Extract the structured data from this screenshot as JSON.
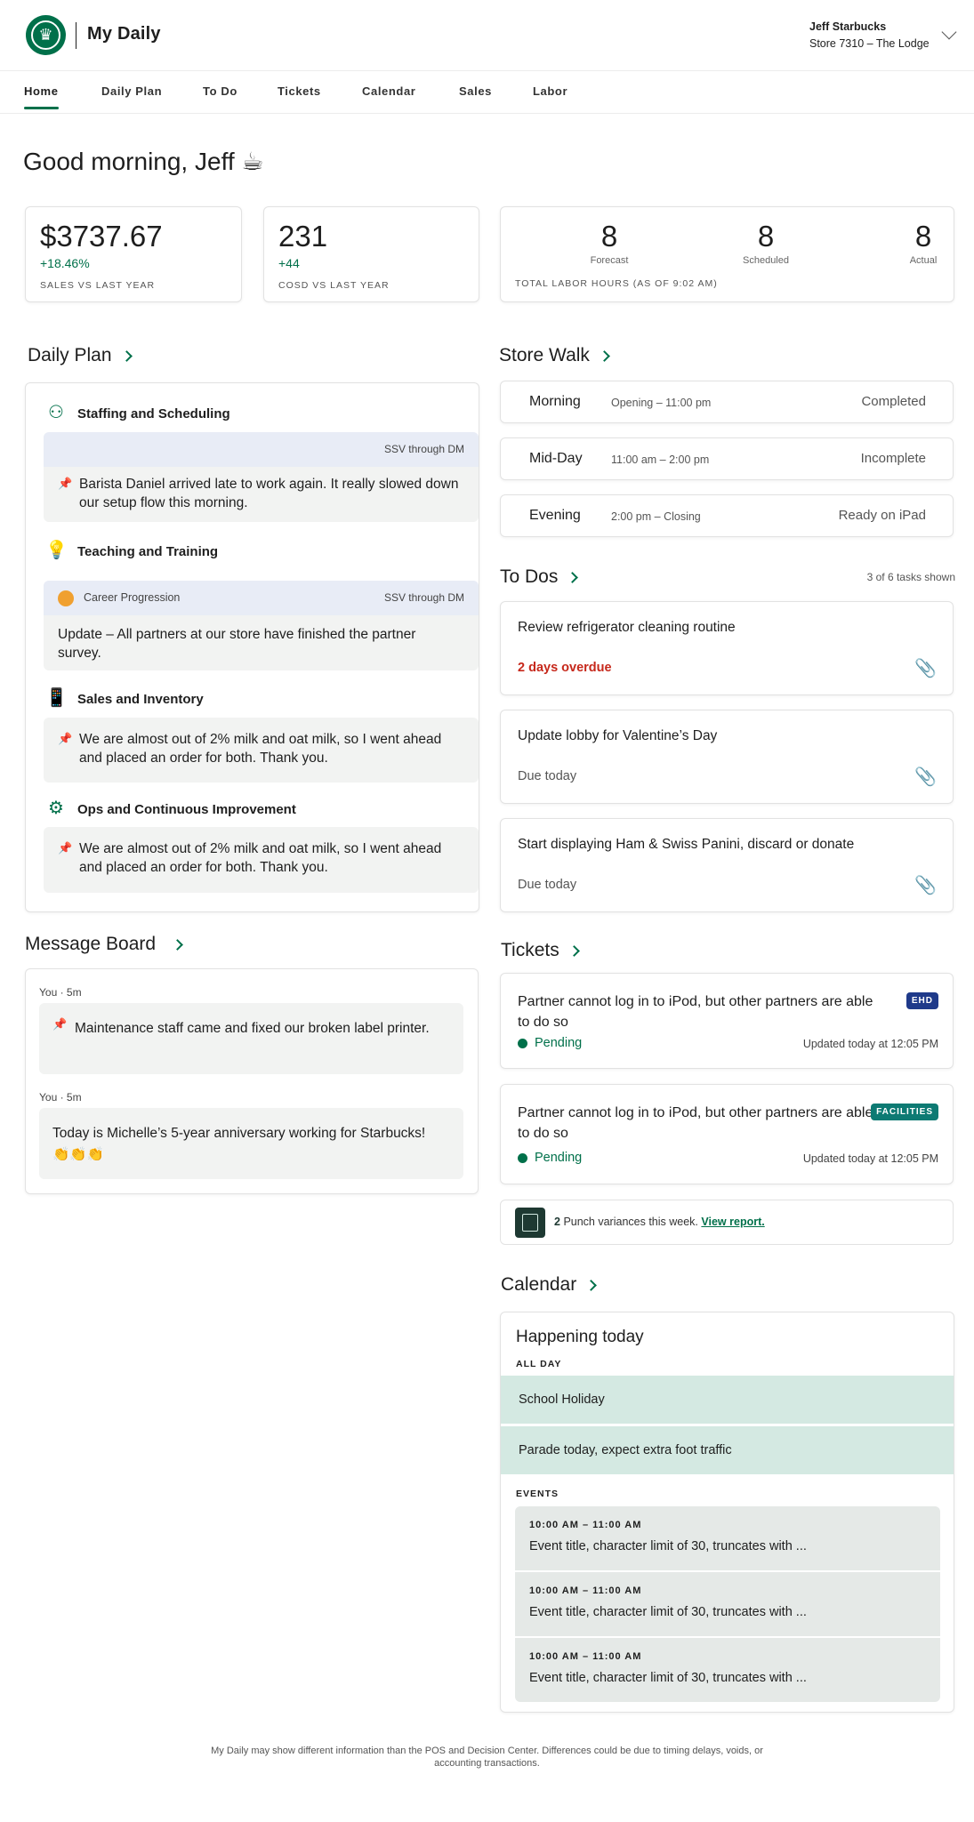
{
  "header": {
    "app_title": "My Daily",
    "user_name": "Jeff Starbucks",
    "store": "Store 7310 – The Lodge"
  },
  "nav": {
    "tabs": [
      {
        "label": "Home",
        "active": true
      },
      {
        "label": "Daily Plan"
      },
      {
        "label": "To Do"
      },
      {
        "label": "Tickets"
      },
      {
        "label": "Calendar"
      },
      {
        "label": "Sales"
      },
      {
        "label": "Labor"
      }
    ]
  },
  "greeting": "Good morning, Jeff ☕",
  "metrics": {
    "sales": {
      "value": "$3737.67",
      "delta": "+18.46%",
      "label": "SALES VS LAST YEAR"
    },
    "cosd": {
      "value": "231",
      "delta": "+44",
      "label": "COSD VS LAST YEAR"
    },
    "labor": {
      "forecast": "8",
      "forecast_label": "Forecast",
      "scheduled": "8",
      "scheduled_label": "Scheduled",
      "actual": "8",
      "actual_label": "Actual",
      "label": "TOTAL LABOR HOURS (AS OF 9:02 AM)"
    }
  },
  "daily_plan": {
    "title": "Daily Plan",
    "items": [
      {
        "title": "Staffing and Scheduling",
        "tag": "SSV through DM",
        "note": "Barista Daniel arrived late to work again. It really slowed down our setup flow this morning."
      },
      {
        "title": "Teaching and Training",
        "head_left": "Career Progression",
        "tag": "SSV through DM",
        "note": "Update – All partners at our store have finished the partner survey."
      },
      {
        "title": "Sales and Inventory",
        "note": "We are almost out of 2% milk and oat milk, so I went ahead and placed an order for both. Thank you."
      },
      {
        "title": "Ops and Continuous Improvement",
        "note": "We are almost out of 2% milk and oat milk, so I went ahead and placed an order for both. Thank you."
      }
    ]
  },
  "message_board": {
    "title": "Message Board",
    "messages": [
      {
        "meta": "You · 5m",
        "text": "Maintenance staff came and fixed our broken label printer."
      },
      {
        "meta": "You · 5m",
        "text": "Today is Michelle’s 5-year anniversary working for Starbucks! 👏👏👏"
      }
    ]
  },
  "store_walk": {
    "title": "Store Walk",
    "rows": [
      {
        "name": "Morning",
        "time": "Opening – 11:00 pm",
        "status": "Completed"
      },
      {
        "name": "Mid-Day",
        "time": "11:00 am – 2:00 pm",
        "status": "Incomplete"
      },
      {
        "name": "Evening",
        "time": "2:00 pm – Closing",
        "status": "Ready on iPad"
      }
    ]
  },
  "todos": {
    "title": "To Dos",
    "count": "3 of 6 tasks shown",
    "items": [
      {
        "title": "Review refrigerator cleaning routine",
        "due": "2 days overdue"
      },
      {
        "title": "Update lobby for Valentine’s Day",
        "due": "Due today"
      },
      {
        "title": "Start displaying Ham & Swiss Panini, discard or donate",
        "due": "Due today"
      }
    ]
  },
  "tickets": {
    "title": "Tickets",
    "items": [
      {
        "title": "Partner cannot log in to iPod, but other partners are able to do so",
        "badge": "EHD",
        "badge_color": "#1f3a8a",
        "status": "Pending",
        "updated": "Updated today at 12:05 PM"
      },
      {
        "title": "Partner cannot log in to iPod, but other partners are able to do so",
        "badge": "FACILITIES",
        "badge_color": "#0d7a73",
        "status": "Pending",
        "updated": "Updated today at 12:05 PM"
      }
    ],
    "punch": {
      "count": "2",
      "text": "Punch variances this week.",
      "link": "View report."
    }
  },
  "calendar": {
    "title": "Calendar",
    "heading": "Happening today",
    "all_day_label": "ALL DAY",
    "all_day": [
      "School Holiday",
      "Parade today, expect extra foot traffic"
    ],
    "events_label": "EVENTS",
    "events": [
      {
        "time": "10:00 AM – 11:00 AM",
        "title": "Event title, character limit of 30, truncates with ..."
      },
      {
        "time": "10:00 AM – 11:00 AM",
        "title": "Event title, character limit of 30, truncates with ..."
      },
      {
        "time": "10:00 AM – 11:00 AM",
        "title": "Event title, character limit of 30, truncates with ..."
      }
    ]
  },
  "footer": {
    "line1": "My Daily may show different information than the POS and Decision Center. Differences could be due to timing delays, voids, or",
    "line2": "accounting transactions."
  },
  "colors": {
    "brand": "#00704a",
    "overdue": "#c6281b"
  }
}
